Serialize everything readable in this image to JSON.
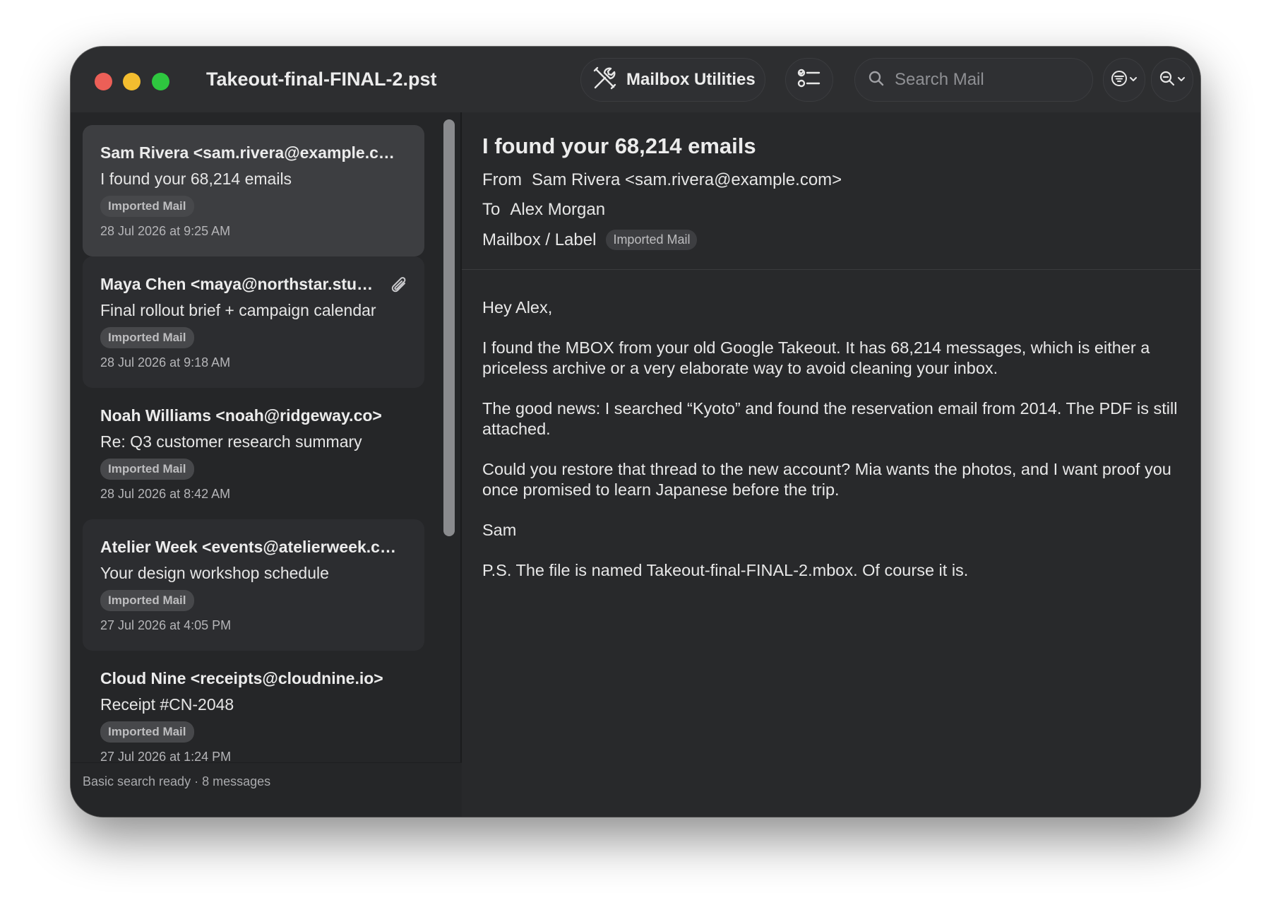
{
  "window": {
    "title": "Takeout-final-FINAL-2.pst"
  },
  "toolbar": {
    "utilities_label": "Mailbox Utilities",
    "utilities_icon": "tools-icon",
    "checklist_icon": "checklist-icon",
    "search_placeholder": "Search Mail",
    "search_value": "",
    "filter_icon": "filter-icon",
    "zoom_icon": "zoom-icon"
  },
  "messages": [
    {
      "from": "Sam Rivera <sam.rivera@example.com>",
      "subject": "I found your 68,214 emails",
      "label": "Imported Mail",
      "date": "28 Jul 2026 at 9:25 AM",
      "attachment": false,
      "selected": true
    },
    {
      "from": "Maya Chen <maya@northstar.studio>",
      "subject": "Final rollout brief + campaign calendar",
      "label": "Imported Mail",
      "date": "28 Jul 2026 at 9:18 AM",
      "attachment": true,
      "selected": false
    },
    {
      "from": "Noah Williams <noah@ridgeway.co>",
      "subject": "Re: Q3 customer research summary",
      "label": "Imported Mail",
      "date": "28 Jul 2026 at 8:42 AM",
      "attachment": false,
      "selected": false
    },
    {
      "from": "Atelier Week <events@atelierweek.com>",
      "subject": "Your design workshop schedule",
      "label": "Imported Mail",
      "date": "27 Jul 2026 at 4:05 PM",
      "attachment": false,
      "selected": false
    },
    {
      "from": "Cloud Nine <receipts@cloudnine.io>",
      "subject": "Receipt #CN-2048",
      "label": "Imported Mail",
      "date": "27 Jul 2026 at 1:24 PM",
      "attachment": false,
      "selected": false
    }
  ],
  "status": "Basic search ready · 8 messages",
  "reader": {
    "title": "I found your 68,214 emails",
    "from_label": "From",
    "from_value": "Sam Rivera <sam.rivera@example.com>",
    "to_label": "To",
    "to_value": "Alex Morgan",
    "mailbox_label": "Mailbox / Label",
    "mailbox_badge": "Imported Mail",
    "body": [
      "Hey Alex,",
      "I found the MBOX from your old Google Takeout. It has 68,214 messages, which is either a priceless archive or a very elaborate way to avoid cleaning your inbox.",
      "The good news: I searched “Kyoto” and found the reservation email from 2014. The PDF is still attached.",
      "Could you restore that thread to the new account? Mia wants the photos, and I want proof you once promised to learn Japanese before the trip.",
      "Sam",
      "P.S. The file is named Takeout-final-FINAL-2.mbox. Of course it is."
    ]
  },
  "colors": {
    "window_bg": "#28292b",
    "sidebar_bg": "#252628",
    "selected_card": "#3d3e41",
    "close": "#ec5f57",
    "minimize": "#f3bd2f",
    "zoom": "#2ec73f"
  }
}
